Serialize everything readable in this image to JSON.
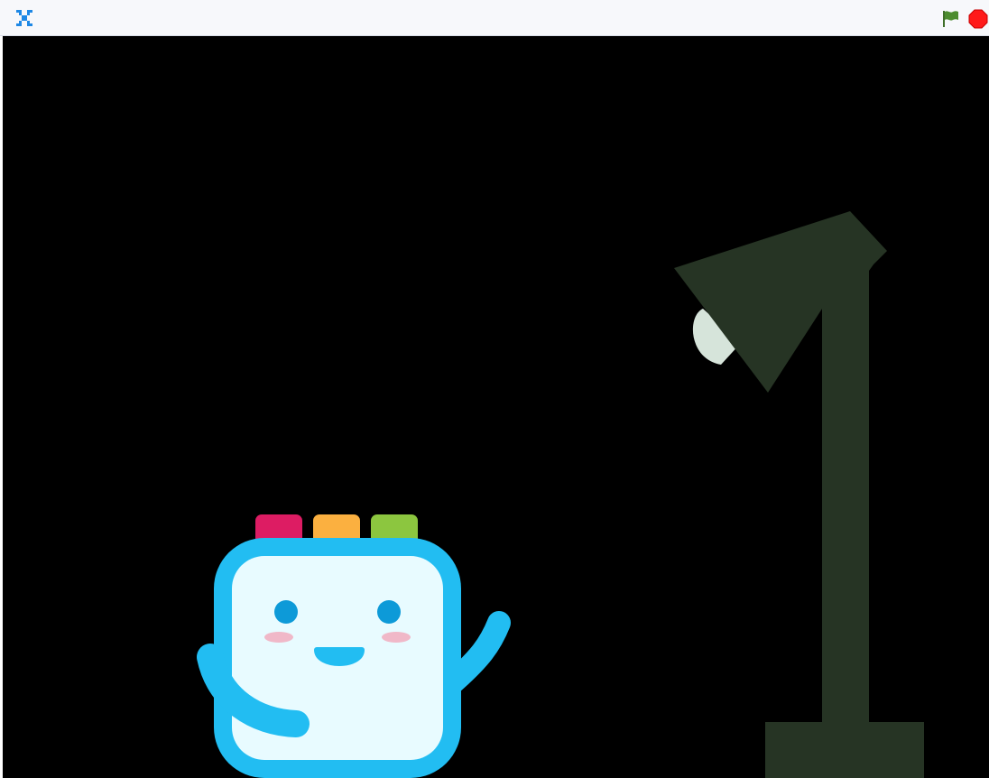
{
  "player": {
    "controls": {
      "fullscreen_icon": "fullscreen-toggle-icon",
      "green_flag_icon": "green-flag-icon",
      "stop_icon": "stop-sign-icon",
      "green_flag_color": "#4c8c2f",
      "stop_color": "#ff1a1a",
      "fullscreen_color": "#1e88e5"
    },
    "stage": {
      "background_color": "#000000",
      "sprites": [
        {
          "name": "Lamp",
          "color_body": "#263424",
          "color_bulb": "#d6e4da"
        },
        {
          "name": "Robot",
          "color_outline": "#22bdf2",
          "color_face": "#e8fbff",
          "color_eyes": "#0d9ad8",
          "color_cheeks": "#f0b8c8",
          "color_button_1": "#dd1c63",
          "color_button_2": "#fbb040",
          "color_button_3": "#8cc63f"
        }
      ]
    }
  }
}
